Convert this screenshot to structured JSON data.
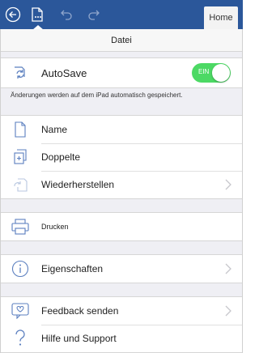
{
  "titlebar": {
    "home_tab": "Home",
    "colors": {
      "bar": "#2b579a"
    }
  },
  "panel": {
    "title": "Datei",
    "autosave": {
      "label": "AutoSave",
      "toggle_label": "EIN",
      "toggle_on": true,
      "note": "Änderungen werden auf dem iPad automatisch gespeichert."
    },
    "file_items": [
      {
        "label": "Name",
        "icon": "document-icon",
        "enabled": true
      },
      {
        "label": "Doppelte",
        "icon": "duplicate-icon",
        "enabled": true
      },
      {
        "label": "Wiederherstellen",
        "icon": "restore-icon",
        "enabled": false,
        "has_chevron": true
      }
    ],
    "print": {
      "label": "Drucken",
      "icon": "printer-icon"
    },
    "properties": {
      "label": "Eigenschaften",
      "icon": "info-icon",
      "has_chevron": true
    },
    "help_items": [
      {
        "label": "Feedback senden",
        "icon": "feedback-icon",
        "has_chevron": true
      },
      {
        "label": "Hilfe und Support",
        "icon": "help-icon",
        "has_chevron": false
      }
    ],
    "colors": {
      "toggle_on": "#4cd964",
      "background": "#efeff4"
    }
  }
}
